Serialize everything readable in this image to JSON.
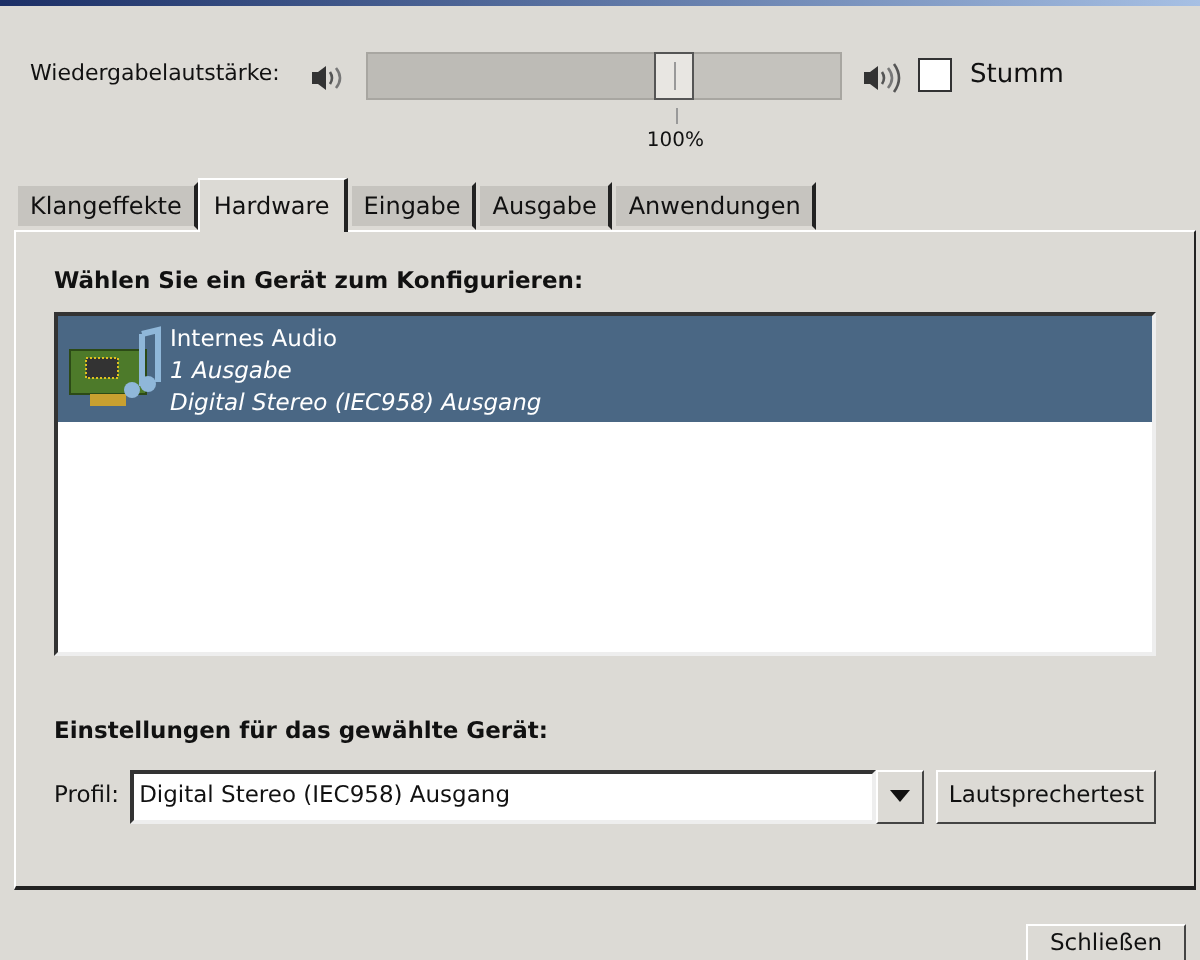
{
  "volume": {
    "label": "Wiedergabelautstärke:",
    "level": 0.65,
    "reading": "100%",
    "mute": {
      "label": "Stumm",
      "checked": false
    }
  },
  "tabs": [
    {
      "label": "Klangeffekte",
      "selected": false
    },
    {
      "label": "Hardware",
      "selected": true
    },
    {
      "label": "Eingabe",
      "selected": false
    },
    {
      "label": "Ausgabe",
      "selected": false
    },
    {
      "label": "Anwendungen",
      "selected": false
    }
  ],
  "device_list": {
    "heading": "Wählen Sie ein Gerät zum Konfigurieren:",
    "items": [
      {
        "name": "Internes Audio",
        "outputs": "1 Ausgabe",
        "profile": "Digital Stereo (IEC958) Ausgang",
        "selected": true
      }
    ]
  },
  "settings": {
    "heading": "Einstellungen für das gewählte Gerät:",
    "profile_label": "Profil:",
    "profile_value": "Digital Stereo (IEC958) Ausgang",
    "test_button": "Lautsprechertest"
  },
  "close_button": "Schließen"
}
